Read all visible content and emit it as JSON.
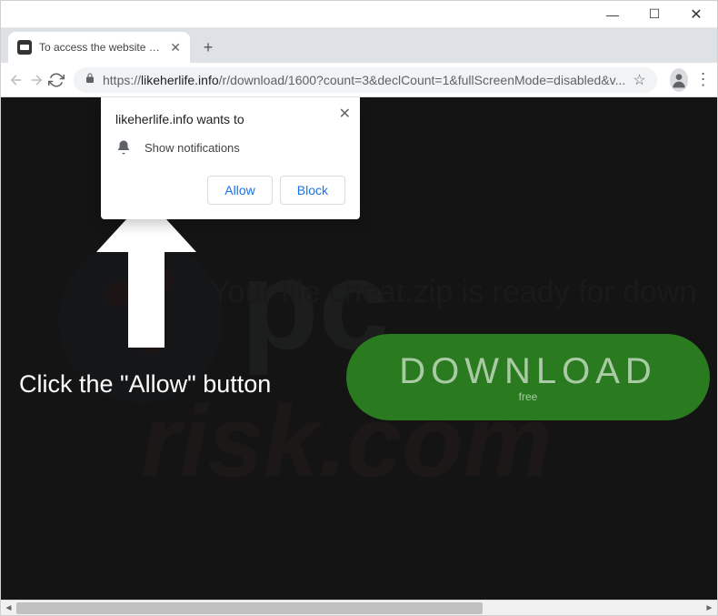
{
  "window": {
    "minimize": "—",
    "maximize": "☐",
    "close": "✕"
  },
  "tab": {
    "title": "To access the website click the \"A",
    "close": "✕",
    "newtab": "+"
  },
  "address": {
    "scheme": "https://",
    "host": "likeherlife.info",
    "path": "/r/download/1600?count=3&declCount=1&fullScreenMode=disabled&v..."
  },
  "popup": {
    "title": "likeherlife.info wants to",
    "permission": "Show notifications",
    "allow": "Allow",
    "block": "Block",
    "close": "✕"
  },
  "page": {
    "instruction": "Click the \"Allow\" button",
    "file_ready": "Your file cheat.zip is ready for down",
    "download_main": "DOWNLOAD",
    "download_sub": "free"
  }
}
